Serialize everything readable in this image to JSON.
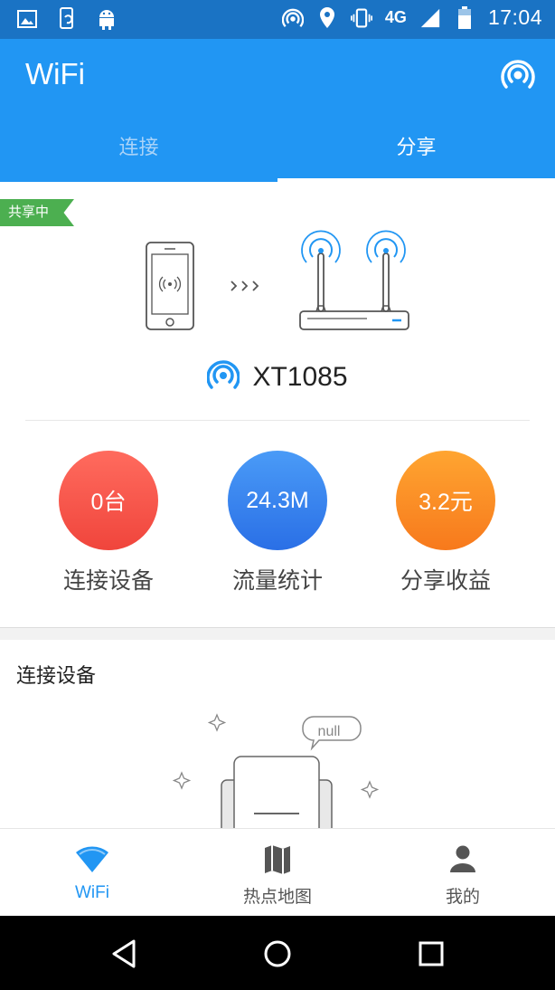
{
  "status_bar": {
    "time": "17:04",
    "network": "4G",
    "left_icons": [
      "image-icon",
      "phone-rotate-icon",
      "android-icon"
    ],
    "right_icons": [
      "hotspot-icon",
      "location-icon",
      "vibrate-icon",
      "signal-icon",
      "battery-icon"
    ]
  },
  "app_bar": {
    "title": "WiFi",
    "action_icon": "hotspot-icon"
  },
  "tabs": [
    {
      "label": "连接",
      "active": false
    },
    {
      "label": "分享",
      "active": true
    }
  ],
  "share_card": {
    "badge": "共享中",
    "ssid": "XT1085",
    "stats": [
      {
        "value": "0台",
        "label": "连接设备",
        "color_top": "#ff6b5e",
        "color_bottom": "#f0453c"
      },
      {
        "value": "24.3M",
        "label": "流量统计",
        "color_top": "#4a9bf7",
        "color_bottom": "#2a6fe6"
      },
      {
        "value": "3.2元",
        "label": "分享收益",
        "color_top": "#ffa531",
        "color_bottom": "#f7791c"
      }
    ]
  },
  "devices_section": {
    "title": "连接设备",
    "empty_bubble": "null"
  },
  "bottom_nav": [
    {
      "label": "WiFi",
      "icon": "wifi-icon",
      "active": true
    },
    {
      "label": "热点地图",
      "icon": "map-icon",
      "active": false
    },
    {
      "label": "我的",
      "icon": "person-icon",
      "active": false
    }
  ],
  "colors": {
    "primary": "#2196f3",
    "status_bar": "#1a73c4",
    "badge": "#4caf50"
  }
}
